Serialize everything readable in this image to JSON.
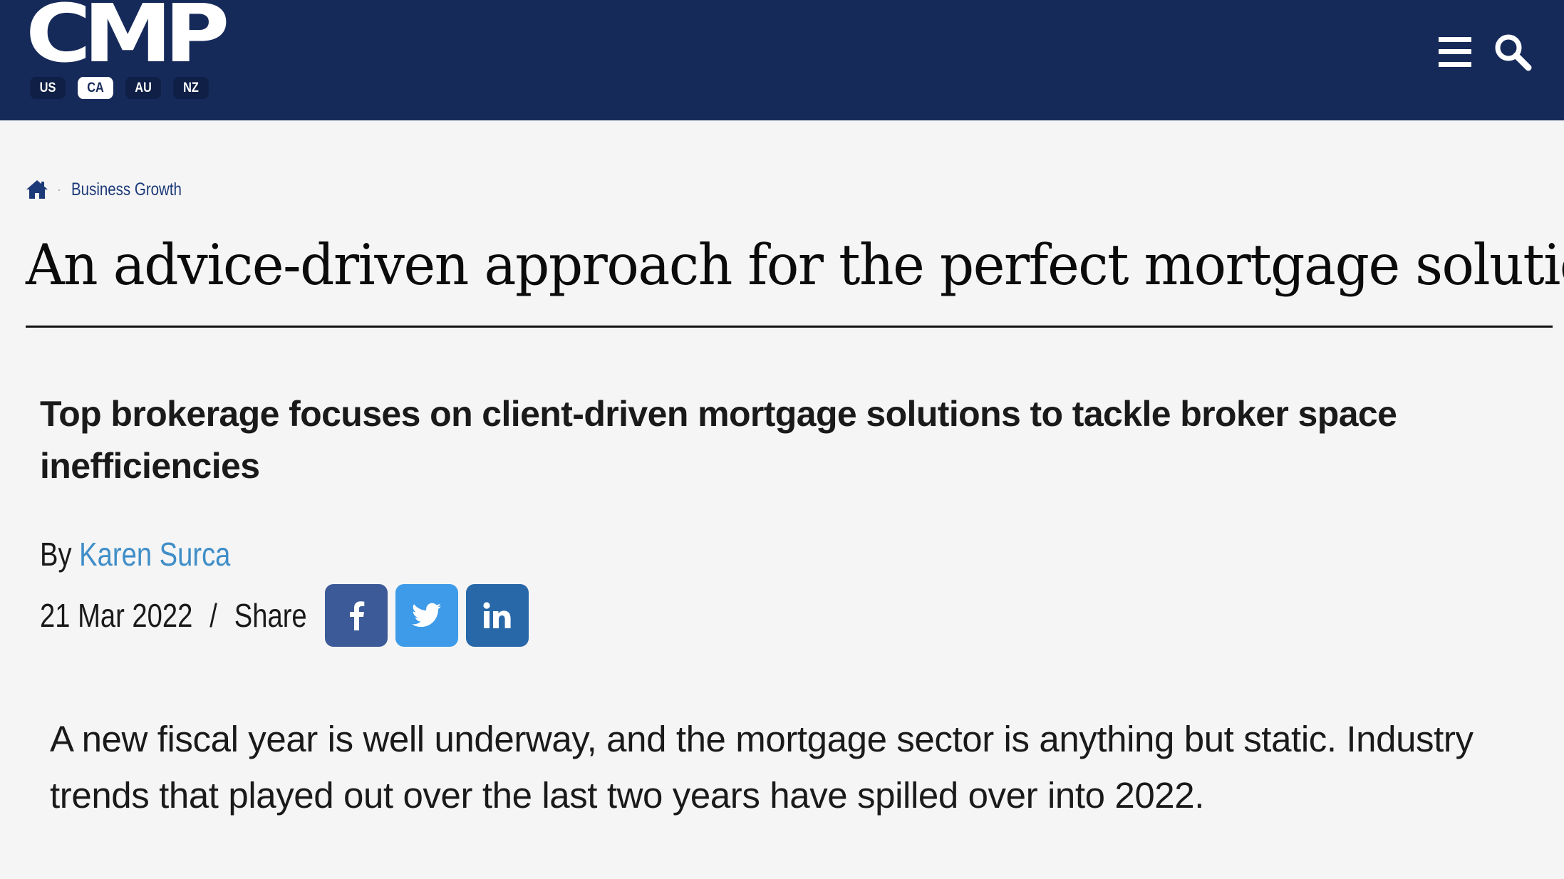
{
  "header": {
    "logo_text": "CMP",
    "regions": [
      {
        "label": "US",
        "active": false
      },
      {
        "label": "CA",
        "active": true
      },
      {
        "label": "AU",
        "active": false
      },
      {
        "label": "NZ",
        "active": false
      }
    ],
    "menu_icon": "hamburger-menu-icon",
    "search_icon": "search-icon",
    "colors": {
      "background": "#162a5a",
      "pill": "#0f1f45",
      "pill_active": "#ffffff"
    }
  },
  "breadcrumb": {
    "home_icon": "home-icon",
    "separator": "·",
    "category": "Business Growth"
  },
  "article": {
    "title": "An advice-driven approach for the perfect mortgage solution",
    "subtitle": "Top brokerage focuses on client-driven mortgage solutions to tackle broker space inefficiencies",
    "byline_prefix": "By",
    "author": "Karen Surca",
    "date": "21 Mar 2022",
    "meta_separator": "/",
    "share_label": "Share",
    "share": [
      {
        "network": "facebook",
        "icon": "facebook-icon",
        "glyph": "f",
        "color": "#3c5a98"
      },
      {
        "network": "twitter",
        "icon": "twitter-icon",
        "glyph": "bird",
        "color": "#3d9be9"
      },
      {
        "network": "linkedin",
        "icon": "linkedin-icon",
        "glyph": "in",
        "color": "#2868a8"
      }
    ],
    "lead": "A new fiscal year is well underway, and the mortgage sector is anything but static. Industry trends that played out over the last two years have spilled over into 2022."
  }
}
